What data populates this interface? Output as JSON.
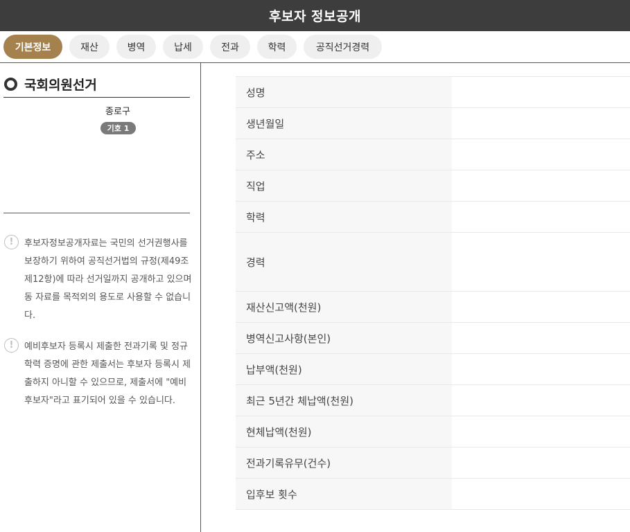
{
  "header": {
    "title": "후보자 정보공개"
  },
  "tabs": [
    {
      "label": "기본정보",
      "active": true
    },
    {
      "label": "재산",
      "active": false
    },
    {
      "label": "병역",
      "active": false
    },
    {
      "label": "납세",
      "active": false
    },
    {
      "label": "전과",
      "active": false
    },
    {
      "label": "학력",
      "active": false
    },
    {
      "label": "공직선거경력",
      "active": false
    }
  ],
  "sidebar": {
    "election_title": "국회의원선거",
    "district": "종로구",
    "ballot": "기호 1",
    "notices": [
      "후보자정보공개자료는 국민의 선거권행사를 보장하기 위하여 공직선거법의 규정(제49조 제12항)에 따라 선거일까지 공개하고 있으며 동 자료를 목적외의 용도로 사용할 수 없습니다.",
      "예비후보자 등록시 제출한 전과기록 및 정규학력 증명에 관한 제출서는 후보자 등록시 제출하지 아니할 수 있으므로, 제출서에 \"예비후보자\"라고 표기되어 있을 수 있습니다."
    ]
  },
  "info_table": {
    "rows": [
      {
        "label": "성명",
        "value": ""
      },
      {
        "label": "생년월일",
        "value": ""
      },
      {
        "label": "주소",
        "value": ""
      },
      {
        "label": "직업",
        "value": ""
      },
      {
        "label": "학력",
        "value": ""
      },
      {
        "label": "경력",
        "value": ""
      },
      {
        "label": "재산신고액(천원)",
        "value": ""
      },
      {
        "label": "병역신고사항(본인)",
        "value": ""
      },
      {
        "label": "납부액(천원)",
        "value": ""
      },
      {
        "label": "최근 5년간 체납액(천원)",
        "value": ""
      },
      {
        "label": "현체납액(천원)",
        "value": ""
      },
      {
        "label": "전과기록유무(건수)",
        "value": ""
      },
      {
        "label": "입후보 횟수",
        "value": ""
      }
    ]
  },
  "colors": {
    "header_bg": "#3d3d3d",
    "tab_active": "#a5814e",
    "tab_inactive": "#efefef",
    "badge": "#7a7a7a"
  }
}
